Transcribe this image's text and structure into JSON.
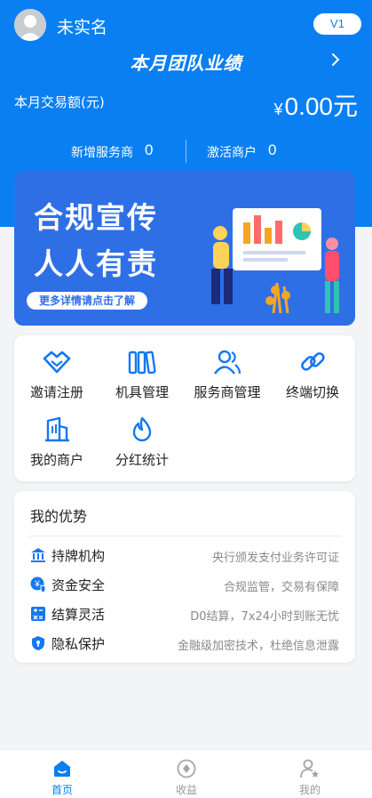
{
  "colors": {
    "primary": "#0a7ff2",
    "banner": "#2f6fe6",
    "background": "#f3f4f6"
  },
  "header": {
    "username": "未实名",
    "level_badge": "V1",
    "performance_title": "本月团队业绩",
    "trade_label": "本月交易额(元)",
    "trade_currency": "¥",
    "trade_amount": "0.00元",
    "stats": [
      {
        "label": "新增服务商",
        "value": "0"
      },
      {
        "label": "激活商户",
        "value": "0"
      }
    ]
  },
  "banner": {
    "line1": "合规宣传",
    "line2": "人人有责",
    "button": "更多详情请点击了解"
  },
  "menu": [
    {
      "label": "邀请注册",
      "icon": "handshake-icon"
    },
    {
      "label": "机具管理",
      "icon": "books-icon"
    },
    {
      "label": "服务商管理",
      "icon": "people-icon"
    },
    {
      "label": "终端切换",
      "icon": "link-icon"
    },
    {
      "label": "我的商户",
      "icon": "store-icon"
    },
    {
      "label": "分红统计",
      "icon": "flame-icon"
    }
  ],
  "advantages": {
    "title": "我的优势",
    "items": [
      {
        "name": "持牌机构",
        "desc": "央行颁发支付业务许可证",
        "icon": "bank-icon"
      },
      {
        "name": "资金安全",
        "desc": "合规监管，交易有保障",
        "icon": "yen-shield-icon"
      },
      {
        "name": "结算灵活",
        "desc": "D0结算，7x24小时到账无忧",
        "icon": "calculator-icon"
      },
      {
        "name": "隐私保护",
        "desc": "金融级加密技术，杜绝信息泄露",
        "icon": "shield-lock-icon"
      }
    ]
  },
  "tabbar": [
    {
      "label": "首页",
      "icon": "home-icon",
      "active": true
    },
    {
      "label": "收益",
      "icon": "earnings-icon",
      "active": false
    },
    {
      "label": "我的",
      "icon": "profile-icon",
      "active": false
    }
  ]
}
